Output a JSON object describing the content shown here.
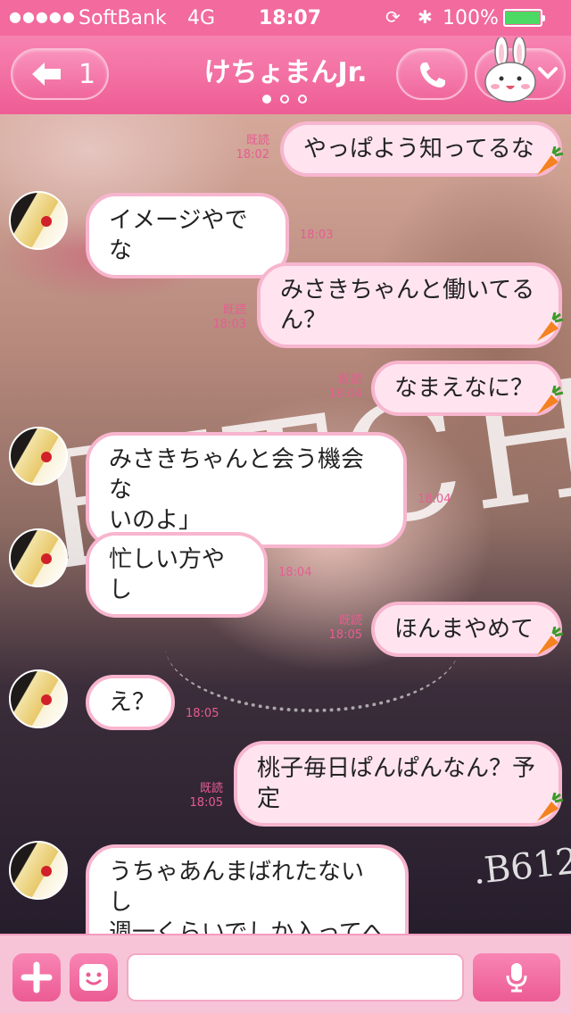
{
  "status_bar": {
    "signal": "●●●●●",
    "carrier": "SoftBank",
    "network": "4G",
    "time": "18:07",
    "battery": "100%"
  },
  "nav": {
    "back_label": "1",
    "title": "けちょまんJr.",
    "page_dots": 3,
    "accent": "#f26a9e"
  },
  "background": {
    "watermark": "BITCH",
    "tag": ".B612"
  },
  "messages": [
    {
      "side": "me",
      "text": "やっぱよう知ってるな",
      "read": "既読",
      "time": "18:02"
    },
    {
      "side": "them",
      "text": "イメージやでな",
      "time": "18:03"
    },
    {
      "side": "me",
      "text": "みさきちゃんと働いてる\nん？",
      "read": "既読",
      "time": "18:03"
    },
    {
      "side": "me",
      "text": "なまえなに？",
      "read": "既読",
      "time": "18:04"
    },
    {
      "side": "them",
      "text": "みさきちゃんと会う機会な\nいのよ」",
      "time": "18:04"
    },
    {
      "side": "them",
      "text": "忙しい方やし",
      "time": "18:04"
    },
    {
      "side": "me",
      "text": "ほんまやめて",
      "read": "既読",
      "time": "18:05"
    },
    {
      "side": "them",
      "text": "え？",
      "time": "18:05"
    },
    {
      "side": "me",
      "text": "桃子毎日ぱんぱんなん？予\n定",
      "read": "既読",
      "time": "18:05"
    },
    {
      "side": "them",
      "text": "うちゃあんまばれたないし\n週一くらいでしか入ってへ\nんねん",
      "time": ""
    }
  ],
  "input": {
    "placeholder": ""
  }
}
